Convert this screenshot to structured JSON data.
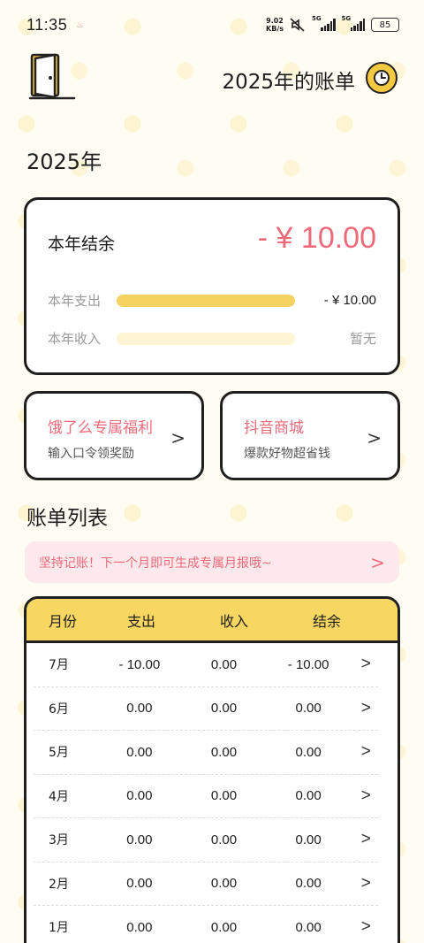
{
  "status_bar": {
    "time": "11:35",
    "net_speed_value": "9.02",
    "net_speed_unit": "KB/s",
    "sim1": "5G",
    "sim2": "5G",
    "battery": "85"
  },
  "header": {
    "title": "2025年的账单",
    "icons": {
      "exit": "door-icon",
      "history": "clock-icon"
    }
  },
  "year_label": "2025年",
  "summary": {
    "balance_label": "本年结余",
    "balance_value": "- ¥ 10.00",
    "expense_label": "本年支出",
    "expense_value": "- ¥ 10.00",
    "expense_fill": 1.0,
    "income_label": "本年收入",
    "income_value": "暂无",
    "income_fill": 0.0
  },
  "promos": [
    {
      "title": "饿了么专属福利",
      "subtitle": "输入口令领奖励"
    },
    {
      "title": "抖音商城",
      "subtitle": "爆款好物超省钱"
    }
  ],
  "list": {
    "title": "账单列表",
    "notice": "坚持记账！下一个月即可生成专属月报哦~",
    "headers": {
      "month": "月份",
      "expense": "支出",
      "income": "收入",
      "balance": "结余"
    },
    "rows": [
      {
        "month": "7月",
        "expense": "- 10.00",
        "income": "0.00",
        "balance": "- 10.00"
      },
      {
        "month": "6月",
        "expense": "0.00",
        "income": "0.00",
        "balance": "0.00"
      },
      {
        "month": "5月",
        "expense": "0.00",
        "income": "0.00",
        "balance": "0.00"
      },
      {
        "month": "4月",
        "expense": "0.00",
        "income": "0.00",
        "balance": "0.00"
      },
      {
        "month": "3月",
        "expense": "0.00",
        "income": "0.00",
        "balance": "0.00"
      },
      {
        "month": "2月",
        "expense": "0.00",
        "income": "0.00",
        "balance": "0.00"
      },
      {
        "month": "1月",
        "expense": "0.00",
        "income": "0.00",
        "balance": "0.00"
      }
    ]
  },
  "colors": {
    "accent_pink": "#ec6b7a",
    "accent_yellow": "#f6d361",
    "border": "#1f1f1f"
  }
}
